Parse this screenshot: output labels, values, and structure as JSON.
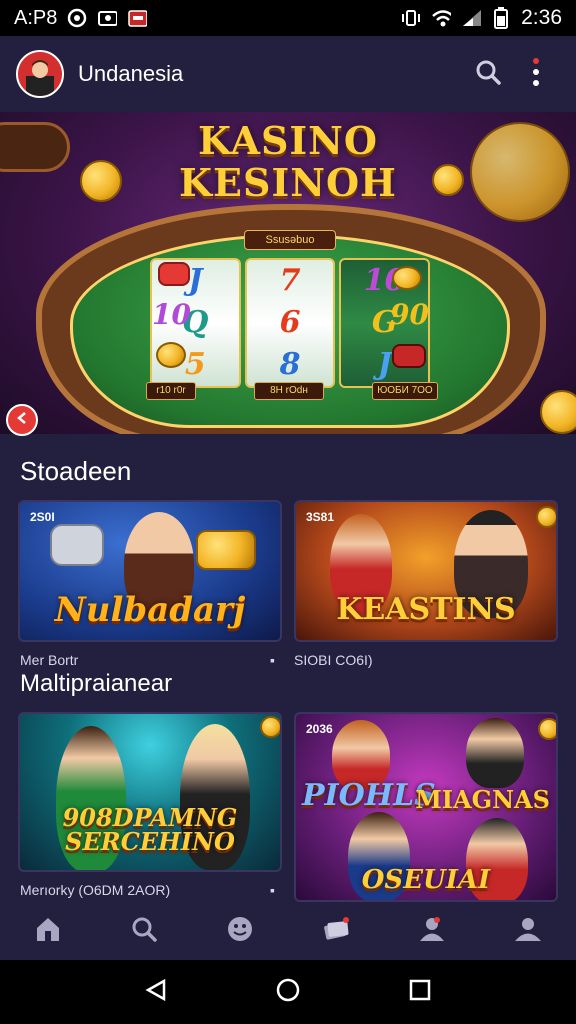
{
  "status_bar": {
    "carrier": "A:P8",
    "time": "2:36"
  },
  "app_bar": {
    "title": "Undanesia"
  },
  "hero": {
    "title_line1": "KASINO",
    "title_line2": "KESINOH",
    "table_label": "Ssusəbuo",
    "reel_symbols": [
      [
        "J",
        "Q",
        "5"
      ],
      [
        "7",
        "6",
        "8"
      ],
      [
        "10",
        "G",
        "J"
      ]
    ],
    "left_symbol": "10",
    "right_symbol": "90",
    "bet_labels": [
      "r10 r0r",
      "8H rOdн",
      "ЮОБИ 7ОО"
    ]
  },
  "section1": {
    "title": "Stoadeen",
    "cards": [
      {
        "badge": "2S0I",
        "logo": "Nulbadarj",
        "accent": "#1a3a8a"
      },
      {
        "badge": "3S81",
        "logo": "KEASTINS",
        "accent": "#b3481b"
      }
    ],
    "caption_left": "Mer Bortr",
    "caption_right": "SIOBI CO6I)"
  },
  "section2": {
    "title": "Maltipraianear",
    "cards": [
      {
        "badge": "",
        "logo_line1": "908DPAMNG",
        "logo_line2": "SERCEHINO",
        "accent": "#0e6f7a"
      },
      {
        "badge": "2036",
        "logo_line1": "PIOHLS",
        "logo_line2": "MIAGNAS",
        "logo_line3": "OSEUIAI",
        "accent": "#6a1f7a"
      }
    ],
    "caption_left": "Merıorky (O6DM 2AOR)"
  },
  "bottom_nav": {
    "items": [
      "home-icon",
      "search-icon",
      "face-icon",
      "cards-icon",
      "profile-icon",
      "group-icon"
    ]
  },
  "colors": {
    "background": "#221f3f",
    "accent_gold": "#ffcf3a",
    "felt_green": "#2f8a45"
  }
}
